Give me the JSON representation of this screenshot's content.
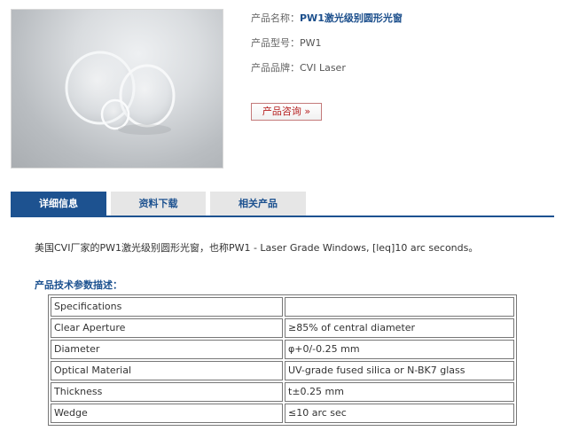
{
  "product": {
    "name_label": "产品名称：",
    "name_value": "PW1激光级别圆形光窗",
    "model_label": "产品型号：",
    "model_value": "PW1",
    "brand_label": "产品品牌：",
    "brand_value": "CVI Laser",
    "inquiry_button": "产品咨询 »"
  },
  "tabs": [
    {
      "label": "详细信息",
      "active": true
    },
    {
      "label": "资料下载",
      "active": false
    },
    {
      "label": "相关产品",
      "active": false
    }
  ],
  "description": "美国CVI厂家的PW1激光级别圆形光窗，也称PW1 - Laser Grade Windows, [leq]10 arc seconds。",
  "specs": {
    "heading": "产品技术参数描述：",
    "rows": [
      {
        "key": "Specifications",
        "value": ""
      },
      {
        "key": "Clear Aperture",
        "value": "≥85% of central diameter"
      },
      {
        "key": "Diameter",
        "value": "φ+0/-0.25 mm"
      },
      {
        "key": "Optical Material",
        "value": "UV-grade fused silica or N-BK7 glass"
      },
      {
        "key": "Thickness",
        "value": "t±0.25 mm"
      },
      {
        "key": "Wedge",
        "value": "≤10 arc sec"
      }
    ]
  },
  "colors": {
    "accent": "#1d5290",
    "button_text": "#b51f1f",
    "tab_inactive_bg": "#e6e6e6"
  }
}
